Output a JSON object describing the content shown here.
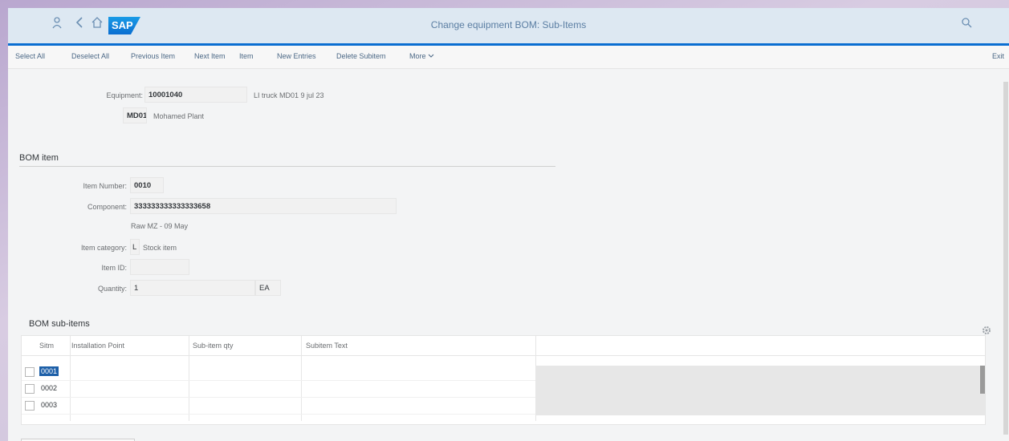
{
  "shell": {
    "title": "Change equipment BOM: Sub-Items",
    "logo": "SAP",
    "icons": [
      "user-icon",
      "back-icon",
      "home-icon",
      "search-icon"
    ]
  },
  "toolbar": {
    "buttons": [
      "Select All",
      "Deselect All",
      "Previous Item",
      "Next Item",
      "Item",
      "New Entries",
      "Delete Subitem",
      "More"
    ],
    "exit": "Exit"
  },
  "header": {
    "equipment_label": "Equipment:",
    "equipment_value": "10001040",
    "equipment_desc": "LI truck MD01 9 jul 23",
    "plant_label": "Plant:",
    "plant_value": "MD01",
    "plant_desc": "Mohamed Plant"
  },
  "bom_item": {
    "section_title": "BOM item",
    "item_number_label": "Item Number:",
    "item_number_value": "0010",
    "component_label": "Component:",
    "component_value": "333333333333333658",
    "component_desc": "Raw MZ - 09 May",
    "item_category_label": "Item category:",
    "item_category_value": "L",
    "item_category_desc": "Stock item",
    "item_id_label": "Item ID:",
    "item_id_value": "",
    "quantity_label": "Quantity:",
    "quantity_value": "1",
    "quantity_unit": "EA"
  },
  "sub_items": {
    "section_title": "BOM sub-items",
    "columns": [
      "Sitm",
      "Installation Point",
      "Sub-item qty",
      "Subitem Text"
    ],
    "rows": [
      {
        "sitm": "0001",
        "installation_point": "",
        "qty": "",
        "text": ""
      },
      {
        "sitm": "0002",
        "installation_point": "",
        "qty": "",
        "text": ""
      },
      {
        "sitm": "0003",
        "installation_point": "",
        "qty": "",
        "text": ""
      }
    ]
  },
  "colors": {
    "accent": "#0a6ed1",
    "shell_bg": "#dde8f2",
    "selection": "#1d5fa8"
  }
}
